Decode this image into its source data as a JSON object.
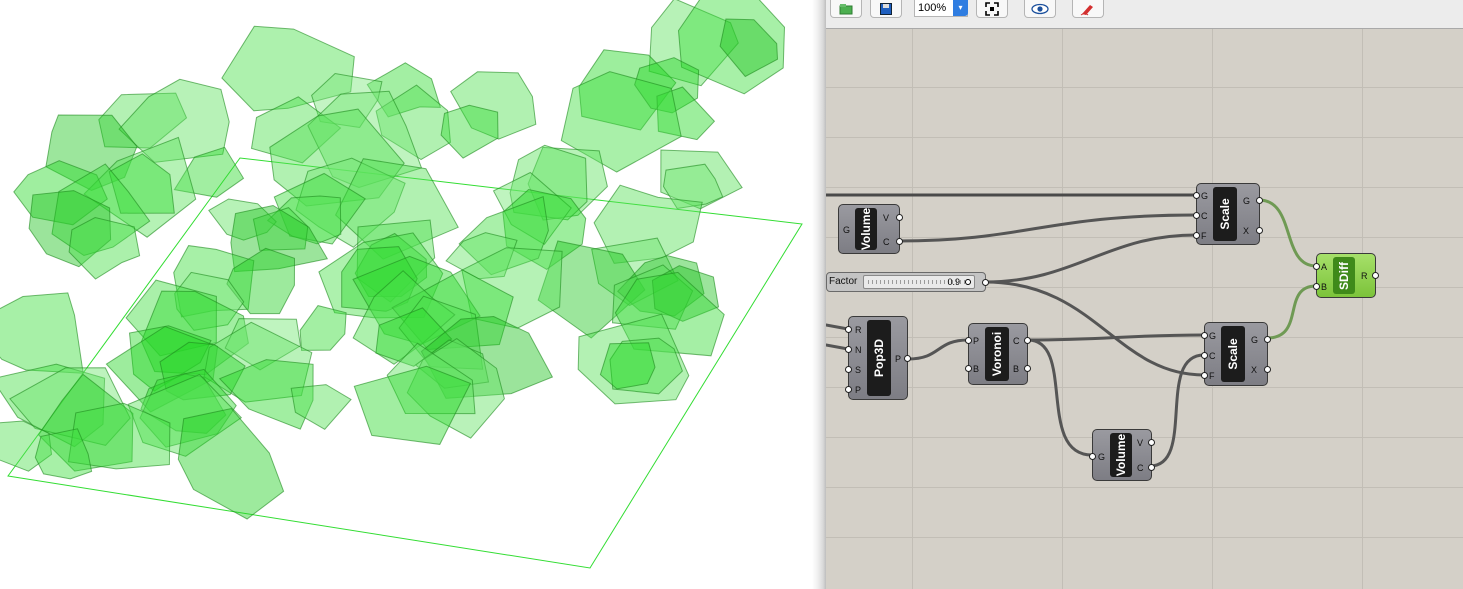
{
  "toolbar": {
    "zoom_value": "100%",
    "buttons": [
      "open-icon",
      "save-icon",
      "zoom-extents-icon",
      "preview-eye-icon",
      "sketch-pen-icon"
    ]
  },
  "viewport": {
    "accent_color": "#33cc33",
    "object": "green-voronoi-cells"
  },
  "canvas": {
    "background_color": "#d4d0c8",
    "components": {
      "volume1": {
        "label": "Volume",
        "inputs": [
          "G"
        ],
        "outputs": [
          "V",
          "C"
        ]
      },
      "scale1": {
        "label": "Scale",
        "inputs": [
          "G",
          "C",
          "F"
        ],
        "outputs": [
          "G",
          "X"
        ]
      },
      "sdiff": {
        "label": "SDiff",
        "inputs": [
          "A",
          "B"
        ],
        "outputs": [
          "R"
        ]
      },
      "pop3d": {
        "label": "Pop3D",
        "inputs": [
          "R",
          "N",
          "S",
          "P"
        ],
        "outputs": [
          "P"
        ]
      },
      "voronoi": {
        "label": "Voronoi",
        "inputs": [
          "P",
          "B"
        ],
        "outputs": [
          "C",
          "B"
        ]
      },
      "scale2": {
        "label": "Scale",
        "inputs": [
          "G",
          "C",
          "F"
        ],
        "outputs": [
          "G",
          "X"
        ]
      },
      "volume2": {
        "label": "Volume",
        "inputs": [
          "G"
        ],
        "outputs": [
          "V",
          "C"
        ]
      }
    },
    "factor_slider": {
      "label": "Factor",
      "value": "0.9"
    }
  }
}
